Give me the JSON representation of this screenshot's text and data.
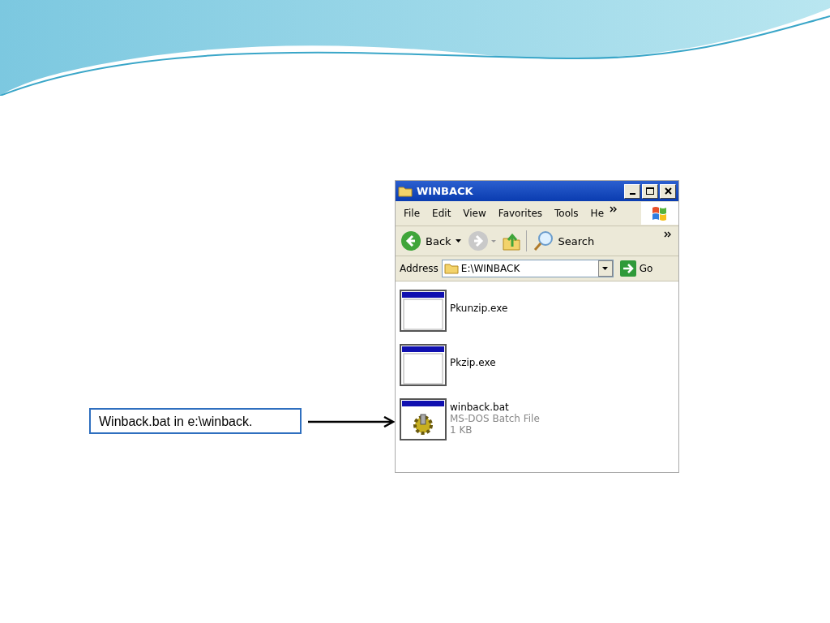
{
  "callout": {
    "text": "Winback.bat in e:\\winback."
  },
  "window": {
    "title": "WINBACK",
    "menu": [
      "File",
      "Edit",
      "View",
      "Favorites",
      "Tools",
      "He"
    ],
    "toolbar": {
      "back": "Back",
      "search": "Search"
    },
    "address": {
      "label": "Address",
      "value": "E:\\WINBACK",
      "go": "Go"
    },
    "files": [
      {
        "name": "Pkunzip.exe",
        "kind": "exe"
      },
      {
        "name": "Pkzip.exe",
        "kind": "exe"
      },
      {
        "name": "winback.bat",
        "kind": "bat",
        "details": [
          "MS-DOS Batch File",
          "1 KB"
        ]
      }
    ]
  }
}
